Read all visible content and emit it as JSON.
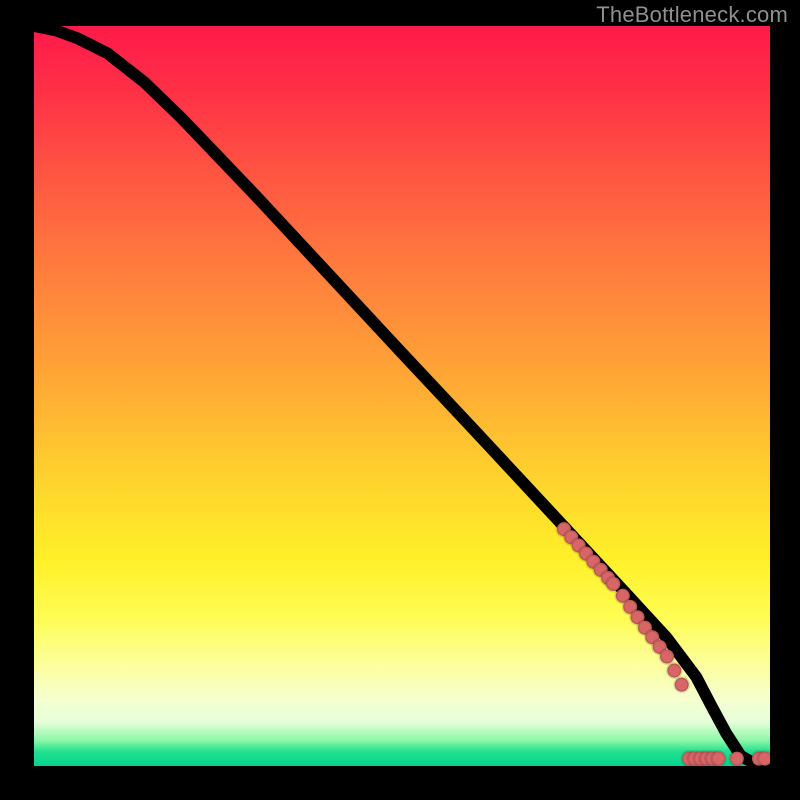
{
  "attribution": "TheBottleneck.com",
  "chart_data": {
    "type": "line",
    "title": "",
    "xlabel": "",
    "ylabel": "",
    "xlim": [
      0,
      100
    ],
    "ylim": [
      0,
      100
    ],
    "grid": false,
    "series": [
      {
        "name": "curve",
        "x": [
          0,
          3,
          6,
          10,
          15,
          20,
          30,
          40,
          50,
          60,
          70,
          80,
          86,
          90,
          92,
          94,
          96,
          98,
          100
        ],
        "y": [
          100,
          99.4,
          98.3,
          96.3,
          92.4,
          87.6,
          77.2,
          66.5,
          55.8,
          45.2,
          34.5,
          23.8,
          17.3,
          12.0,
          8.2,
          4.5,
          1.4,
          0.25,
          0.1
        ]
      }
    ],
    "scatter": [
      {
        "name": "markers-on-curve",
        "points": [
          {
            "x": 72,
            "y": 32.0
          },
          {
            "x": 73,
            "y": 30.9
          },
          {
            "x": 74,
            "y": 29.8
          },
          {
            "x": 75,
            "y": 28.7
          },
          {
            "x": 76,
            "y": 27.6
          },
          {
            "x": 77,
            "y": 26.5
          },
          {
            "x": 78,
            "y": 25.4
          },
          {
            "x": 78.7,
            "y": 24.6
          },
          {
            "x": 80,
            "y": 23.0
          },
          {
            "x": 81,
            "y": 21.5
          },
          {
            "x": 82,
            "y": 20.1
          },
          {
            "x": 83,
            "y": 18.7
          },
          {
            "x": 84,
            "y": 17.4
          },
          {
            "x": 85,
            "y": 16.1
          },
          {
            "x": 86,
            "y": 14.8
          },
          {
            "x": 87,
            "y": 12.9
          },
          {
            "x": 88,
            "y": 11.0
          }
        ]
      },
      {
        "name": "markers-bottom-clump",
        "points": [
          {
            "x": 89.0,
            "y": 1.0
          },
          {
            "x": 89.8,
            "y": 1.0
          },
          {
            "x": 90.6,
            "y": 1.0
          },
          {
            "x": 91.4,
            "y": 1.0
          },
          {
            "x": 92.2,
            "y": 1.0
          },
          {
            "x": 93.0,
            "y": 1.0
          }
        ]
      },
      {
        "name": "markers-bottom-isolated",
        "points": [
          {
            "x": 95.5,
            "y": 1.0
          },
          {
            "x": 98.5,
            "y": 1.0
          },
          {
            "x": 99.3,
            "y": 1.0
          }
        ]
      }
    ]
  }
}
